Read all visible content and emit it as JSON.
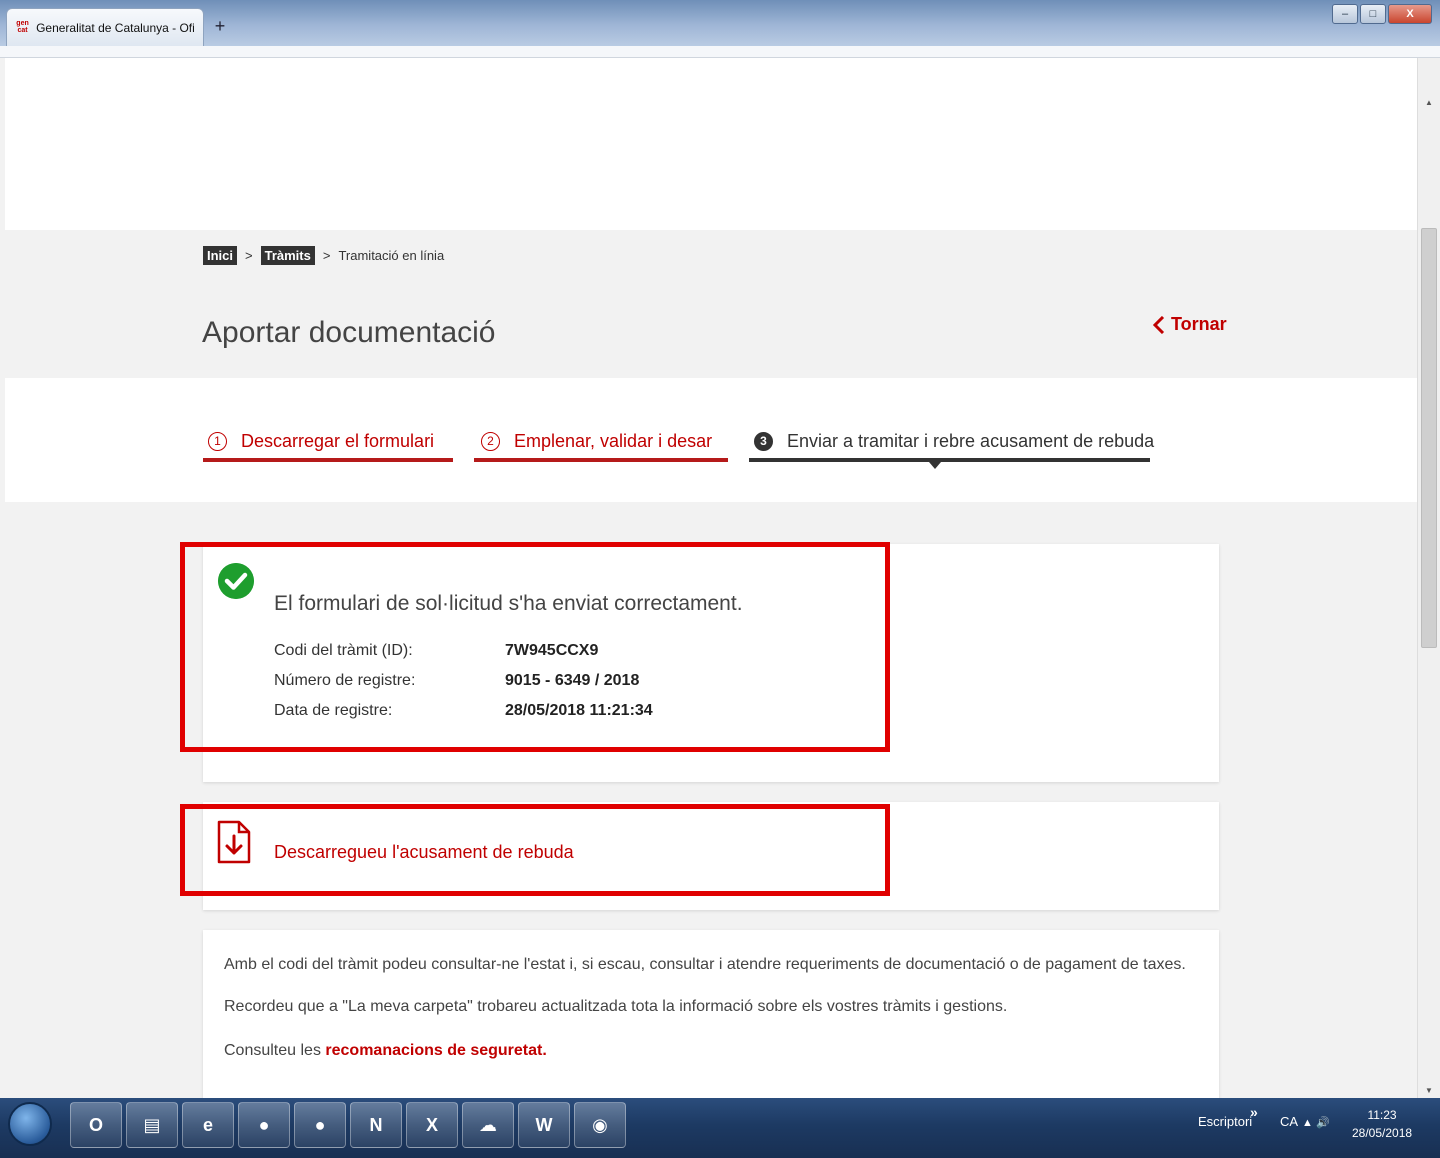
{
  "browser": {
    "tab_title": "Generalitat de Catalunya - Ofi...",
    "favicon_text": "gen cat",
    "new_tab": "+",
    "minimize": "–",
    "maximize": "□",
    "close": "X"
  },
  "breadcrumb": {
    "home": "Inici",
    "sep1": ">",
    "tramits": "Tràmits",
    "sep2": ">",
    "current": "Tramitació en línia"
  },
  "header": {
    "title": "Aportar documentació",
    "back_label": "Tornar"
  },
  "steps": [
    {
      "number": "1",
      "label": "Descarregar el formulari"
    },
    {
      "number": "2",
      "label": "Emplenar, validar i desar"
    },
    {
      "number": "3",
      "label": "Enviar a tramitar i rebre acusament de rebuda"
    }
  ],
  "confirmation": {
    "message": "El formulari de sol·licitud s'ha enviat correctament.",
    "fields": [
      {
        "label": "Codi del tràmit (ID):",
        "value": "7W945CCX9"
      },
      {
        "label": "Número de registre:",
        "value": "9015 - 6349 / 2018"
      },
      {
        "label": "Data de registre:",
        "value": "28/05/2018 11:21:34"
      }
    ]
  },
  "download": {
    "label": "Descarregueu l'acusament de rebuda"
  },
  "info": {
    "line1": "Amb el codi del tràmit podeu consultar-ne l'estat i, si escau, consultar i atendre requeriments de documentació o de pagament de taxes.",
    "line2": "Recordeu que a \"La meva carpeta\" trobareu actualitzada tota la informació sobre els vostres tràmits i gestions.",
    "line3_prefix": "Consulteu les ",
    "line3_link": "recomanacions de seguretat."
  },
  "taskbar": {
    "apps": [
      "outlook",
      "explorer",
      "internet-explorer",
      "chrome",
      "chrome",
      "onenote",
      "excel",
      "onedrive",
      "word",
      "firefox"
    ],
    "toolbar_label": "Escriptori",
    "toolbar_chevron": "»",
    "language": "CA",
    "tray": "▲ 🔊",
    "time": "11:23",
    "date": "28/05/2018"
  },
  "colors": {
    "accent_red": "#c00000",
    "highlight_red": "#e00000",
    "success_green": "#1e9e2e",
    "dark": "#333333"
  }
}
